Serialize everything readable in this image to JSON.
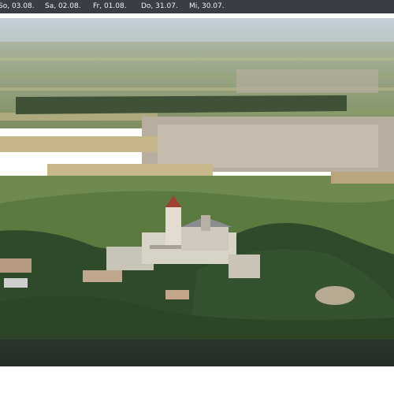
{
  "date_tabs": [
    {
      "label": "So, 03.08."
    },
    {
      "label": "Sa, 02.08."
    },
    {
      "label": "Fr, 01.08."
    },
    {
      "label": "Do, 31.07."
    },
    {
      "label": "Mi, 30.07."
    }
  ],
  "photo": {
    "subject": "castle-on-hill-icon"
  },
  "colors": {
    "bar": "#3a3d45",
    "text": "#f2f2f2",
    "sky": "#c9d3dc",
    "forest": "#2f4a2a"
  }
}
